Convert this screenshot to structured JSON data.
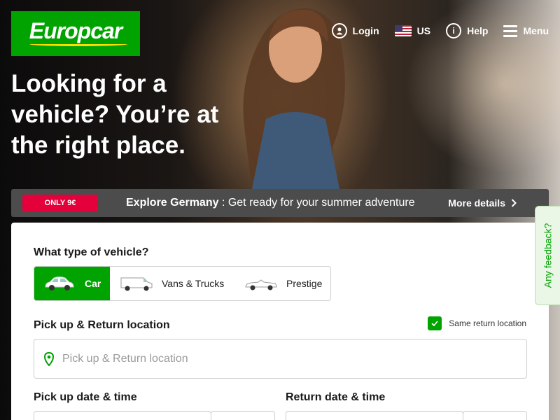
{
  "header": {
    "logo_text": "Europcar",
    "nav": {
      "login": "Login",
      "country": "US",
      "help": "Help",
      "menu": "Menu"
    }
  },
  "hero": {
    "headline": "Looking for a vehicle? You’re at the right place."
  },
  "promo": {
    "badge": "ONLY 9€",
    "title": "Explore Germany",
    "text": " : Get ready for your summer adventure",
    "link": "More details"
  },
  "booking": {
    "vehicle_type_label": "What type of vehicle?",
    "vehicle_types": [
      {
        "label": "Car",
        "icon": "car-icon",
        "selected": true
      },
      {
        "label": "Vans & Trucks",
        "icon": "van-icon",
        "selected": false
      },
      {
        "label": "Prestige",
        "icon": "convertible-icon",
        "selected": false
      }
    ],
    "location_label": "Pick up & Return location",
    "same_return_label": "Same return location",
    "same_return_checked": true,
    "location_placeholder": "Pick up & Return location",
    "pickup_date_label": "Pick up date & time",
    "return_date_label": "Return date & time"
  },
  "feedback": {
    "label": "Any feedback?"
  },
  "colors": {
    "brand_green": "#00a300",
    "promo_red": "#e4003a",
    "logo_swoosh": "#ffdd00"
  }
}
